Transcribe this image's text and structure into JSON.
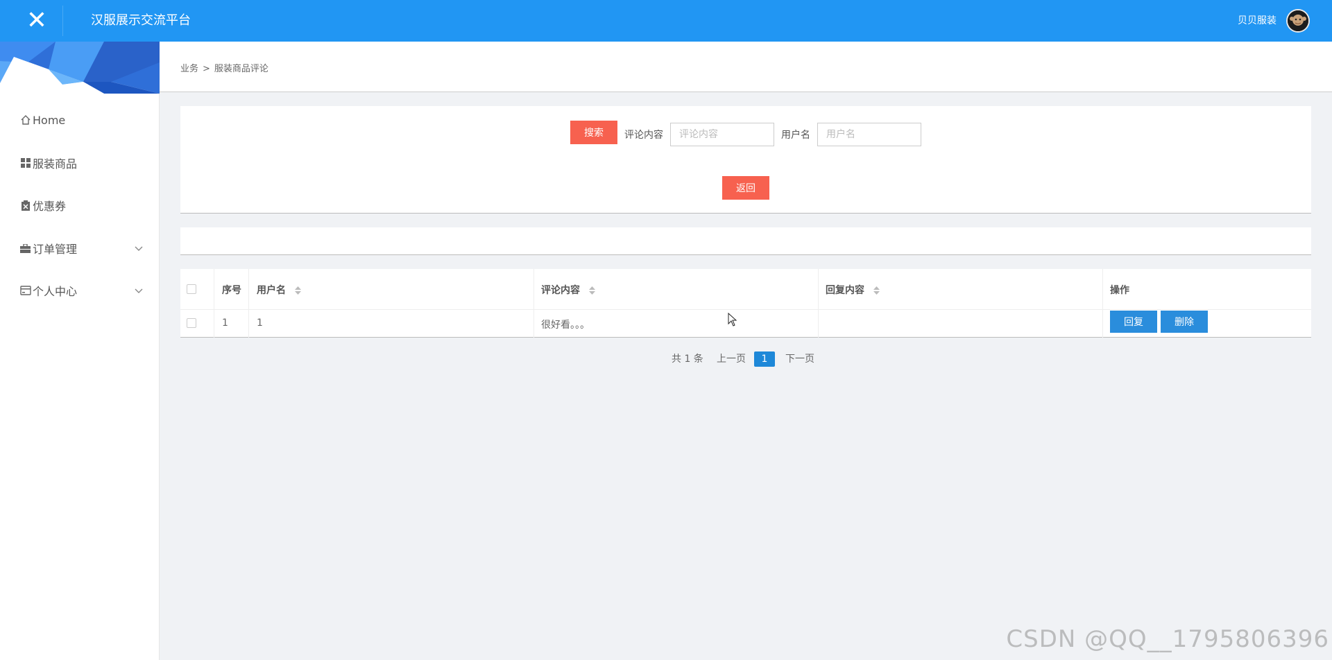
{
  "header": {
    "title": "汉服展示交流平台",
    "user_name": "贝贝服装",
    "menu_toggle_icon": "close-icon"
  },
  "sidebar": {
    "items": [
      {
        "label": "Home",
        "icon": "home-icon"
      },
      {
        "label": "服装商品",
        "icon": "grid-icon"
      },
      {
        "label": "优惠券",
        "icon": "clipboard-icon"
      },
      {
        "label": "订单管理",
        "icon": "briefcase-icon",
        "expandable": true
      },
      {
        "label": "个人中心",
        "icon": "card-icon",
        "expandable": true
      }
    ]
  },
  "breadcrumb": {
    "parent": "业务",
    "separator": ">",
    "current": "服装商品评论"
  },
  "search": {
    "search_button": "搜索",
    "comment_label": "评论内容",
    "comment_placeholder": "评论内容",
    "username_label": "用户名",
    "username_placeholder": "用户名",
    "back_button": "返回"
  },
  "table": {
    "headers": {
      "index": "序号",
      "username": "用户名",
      "comment": "评论内容",
      "reply": "回复内容",
      "actions": "操作"
    },
    "rows": [
      {
        "index": "1",
        "username": "1",
        "comment": "很好看。。。",
        "reply": "",
        "reply_button": "回复",
        "delete_button": "删除"
      }
    ]
  },
  "pagination": {
    "total": "共 1 条",
    "prev": "上一页",
    "current": "1",
    "next": "下一页"
  },
  "watermark": "CSDN @QQ__1795806396",
  "colors": {
    "header_bg": "#2196f3",
    "danger": "#f7614f",
    "primary": "#2a8ddc",
    "page_bg": "#f0f2f5"
  }
}
